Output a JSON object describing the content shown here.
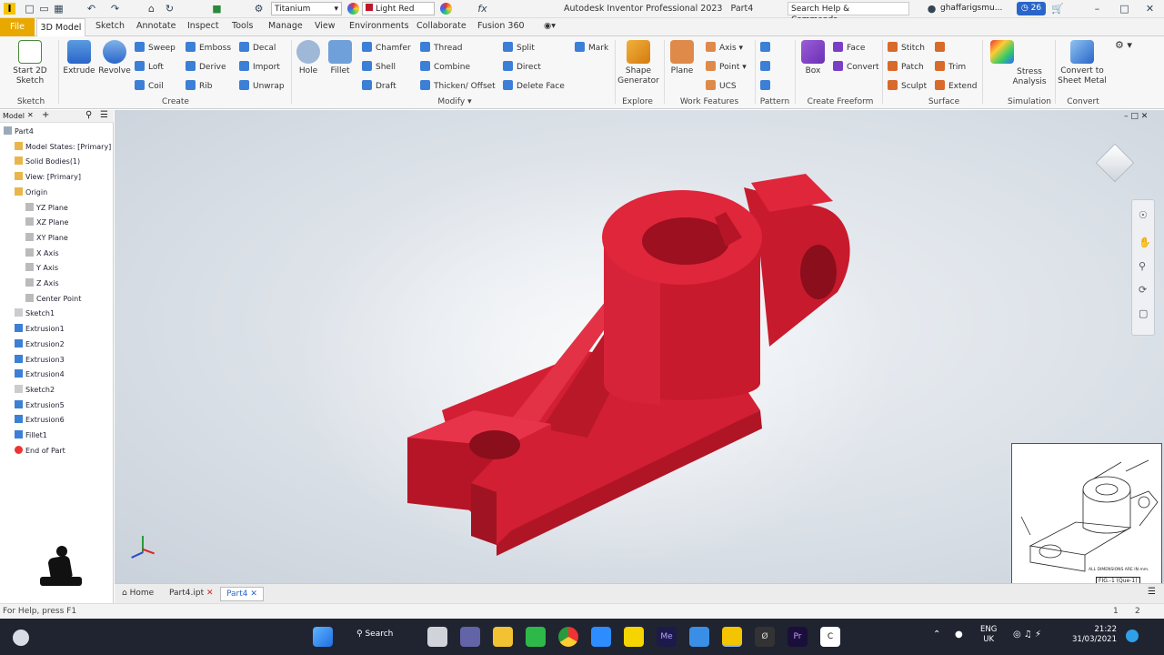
{
  "title_bar": {
    "app_title": "Autodesk Inventor Professional 2023",
    "doc_name": "Part4",
    "material": "Titanium",
    "appearance": "Light Red",
    "search_placeholder": "Search Help & Commands...",
    "user": "ghaffarigsmu...",
    "notif_count": "26"
  },
  "tabs": [
    "File",
    "3D Model",
    "Sketch",
    "Annotate",
    "Inspect",
    "Tools",
    "Manage",
    "View",
    "Environments",
    "Collaborate",
    "Fusion 360"
  ],
  "active_tab": "3D Model",
  "ribbon": {
    "sketch": {
      "start": "Start 2D Sketch",
      "group": "Sketch"
    },
    "create": {
      "extrude": "Extrude",
      "revolve": "Revolve",
      "sweep": "Sweep",
      "emboss": "Emboss",
      "decal": "Decal",
      "loft": "Loft",
      "derive": "Derive",
      "import": "Import",
      "coil": "Coil",
      "rib": "Rib",
      "unwrap": "Unwrap",
      "group": "Create"
    },
    "modify": {
      "hole": "Hole",
      "fillet": "Fillet",
      "chamfer": "Chamfer",
      "thread": "Thread",
      "split": "Split",
      "shell": "Shell",
      "combine": "Combine",
      "direct": "Direct",
      "draft": "Draft",
      "thicken": "Thicken/ Offset",
      "delete_face": "Delete Face",
      "group": "Modify"
    },
    "mark": "Mark",
    "explore": {
      "shape_gen": "Shape Generator",
      "group": "Explore"
    },
    "work": {
      "plane": "Plane",
      "axis": "Axis",
      "point": "Point",
      "ucs": "UCS",
      "group": "Work Features"
    },
    "pattern": {
      "group": "Pattern"
    },
    "freeform": {
      "box": "Box",
      "face": "Face",
      "convert": "Convert",
      "group": "Create Freeform"
    },
    "surface": {
      "stitch": "Stitch",
      "patch": "Patch",
      "sculpt": "Sculpt",
      "trim": "Trim",
      "extend": "Extend",
      "group": "Surface"
    },
    "simulation": {
      "stress": "Stress Analysis",
      "group": "Simulation"
    },
    "convert": {
      "sheet": "Convert to Sheet Metal",
      "group": "Convert"
    }
  },
  "browser": {
    "header": "Model",
    "items": [
      "Part4",
      "Model States: [Primary]",
      "Solid Bodies(1)",
      "View: [Primary]",
      "Origin",
      "YZ Plane",
      "XZ Plane",
      "XY Plane",
      "X Axis",
      "Y Axis",
      "Z Axis",
      "Center Point",
      "Sketch1",
      "Extrusion1",
      "Extrusion2",
      "Extrusion3",
      "Extrusion4",
      "Sketch2",
      "Extrusion5",
      "Extrusion6",
      "Fillet1",
      "End of Part"
    ]
  },
  "doc_tabs": [
    "Home",
    "Part4.ipt",
    "Part4"
  ],
  "status": {
    "left": "For Help, press F1",
    "page_a": "1",
    "page_b": "2"
  },
  "reference": {
    "caption": "FIG.-1 (Que-1)",
    "note": "ALL DIMENSIONS ARE IN mm."
  },
  "taskbar": {
    "search": "Search",
    "lang1": "ENG",
    "lang2": "UK",
    "time": "21:22",
    "date": "31/03/2021"
  },
  "colors": {
    "part_red": "#e0263a",
    "accent": "#2a66c9"
  }
}
